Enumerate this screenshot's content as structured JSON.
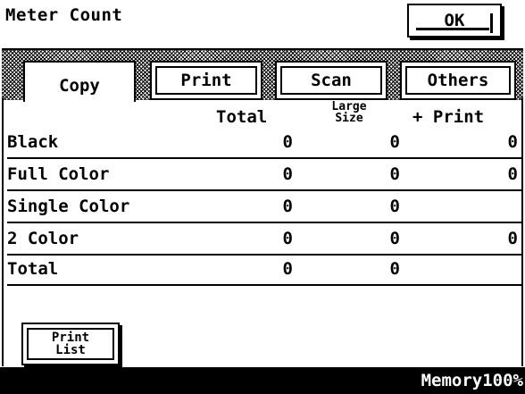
{
  "header": {
    "title": "Meter Count",
    "ok_label": "OK"
  },
  "tabs": [
    {
      "label": "Copy",
      "active": true
    },
    {
      "label": "Print",
      "active": false
    },
    {
      "label": "Scan",
      "active": false
    },
    {
      "label": "Others",
      "active": false
    }
  ],
  "columns": {
    "total": "Total",
    "large_size": "Large\nSize",
    "plus_print": "+ Print"
  },
  "rows": [
    {
      "label": "Black",
      "total": "0",
      "large": "0",
      "print": "0"
    },
    {
      "label": "Full Color",
      "total": "0",
      "large": "0",
      "print": "0"
    },
    {
      "label": "Single Color",
      "total": "0",
      "large": "0",
      "print": ""
    },
    {
      "label": "2 Color",
      "total": "0",
      "large": "0",
      "print": "0"
    },
    {
      "label": "Total",
      "total": "0",
      "large": "0",
      "print": ""
    }
  ],
  "print_list_label": "Print\nList",
  "status": {
    "memory": "Memory100%"
  }
}
